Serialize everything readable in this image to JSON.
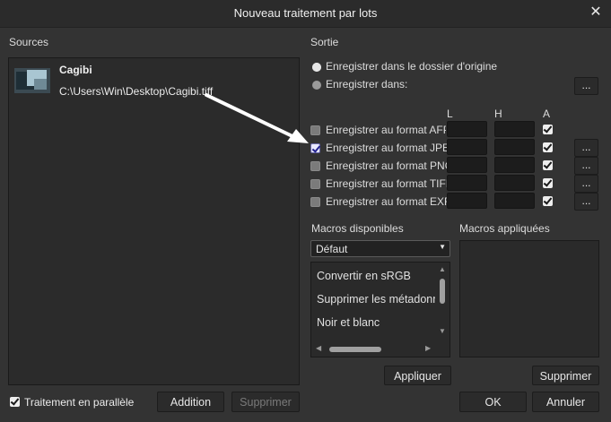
{
  "window": {
    "title": "Nouveau traitement par lots",
    "close_label": "✕"
  },
  "sources": {
    "header": "Sources",
    "file": {
      "name": "Cagibi",
      "path": "C:\\Users\\Win\\Desktop\\Cagibi.tiff"
    },
    "parallel_label": "Traitement en parallèle",
    "add_label": "Addition",
    "remove_label": "Supprimer"
  },
  "output": {
    "header": "Sortie",
    "radio_origin": "Enregistrer dans le dossier d'origine",
    "radio_folder": "Enregistrer dans:",
    "browse_label": "...",
    "col_w": "L",
    "col_h": "H",
    "col_a": "A",
    "formats": [
      {
        "label": "Enregistrer au format AFPhoto",
        "checked": false,
        "auto": true
      },
      {
        "label": "Enregistrer au format JPEG",
        "checked": true,
        "auto": true
      },
      {
        "label": "Enregistrer au format PNG",
        "checked": false,
        "auto": true
      },
      {
        "label": "Enregistrer au format TIFF",
        "checked": false,
        "auto": true
      },
      {
        "label": "Enregistrer au format EXR",
        "checked": false,
        "auto": true
      }
    ]
  },
  "macros": {
    "available_header": "Macros disponibles",
    "applied_header": "Macros appliquées",
    "category": "Défaut",
    "items": [
      "Convertir en sRGB",
      "Supprimer les métadonnées",
      "Noir et blanc"
    ],
    "apply_label": "Appliquer",
    "remove_label": "Supprimer"
  },
  "footer": {
    "ok_label": "OK",
    "cancel_label": "Annuler"
  },
  "colors": {
    "background": "#333333",
    "panel": "#2b2b2b",
    "field": "#1c1c1c",
    "text": "#dcdcdc"
  }
}
